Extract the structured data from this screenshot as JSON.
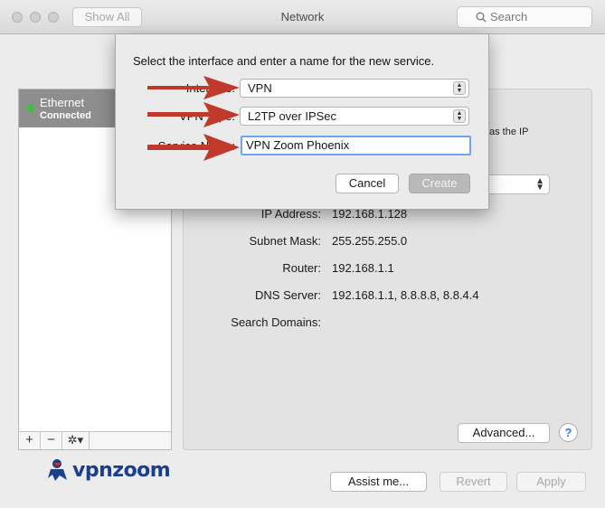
{
  "window": {
    "title": "Network",
    "show_all_label": "Show All",
    "search_placeholder": "Search"
  },
  "sidebar": {
    "items": [
      {
        "name": "Ethernet",
        "status": "Connected",
        "status_color": "#35c33a"
      }
    ],
    "tools": {
      "add": "+",
      "remove": "−",
      "gear": "✲▾"
    }
  },
  "logo": {
    "part1": "vpn",
    "part2": "zoom"
  },
  "detail": {
    "hint_text": "as the IP",
    "ip_address_label": "IP Address:",
    "ip_address_value": "192.168.1.128",
    "subnet_label": "Subnet Mask:",
    "subnet_value": "255.255.255.0",
    "router_label": "Router:",
    "router_value": "192.168.1.1",
    "dns_label": "DNS Server:",
    "dns_value": "192.168.1.1, 8.8.8.8, 8.8.4.4",
    "search_domains_label": "Search Domains:",
    "advanced_label": "Advanced...",
    "help_label": "?"
  },
  "footer": {
    "assist_label": "Assist me...",
    "revert_label": "Revert",
    "apply_label": "Apply"
  },
  "sheet": {
    "title": "Select the interface and enter a name for the new service.",
    "interface_label": "Interface:",
    "interface_value": "VPN",
    "vpn_type_label": "VPN Type:",
    "vpn_type_value": "L2TP over IPSec",
    "service_name_label": "Service Name:",
    "service_name_value": "VPN Zoom Phoenix",
    "cancel_label": "Cancel",
    "create_label": "Create"
  },
  "colors": {
    "arrow": "#c0392b",
    "focus_ring": "#6ea6f0",
    "logo_blue": "#1b3f8f"
  }
}
